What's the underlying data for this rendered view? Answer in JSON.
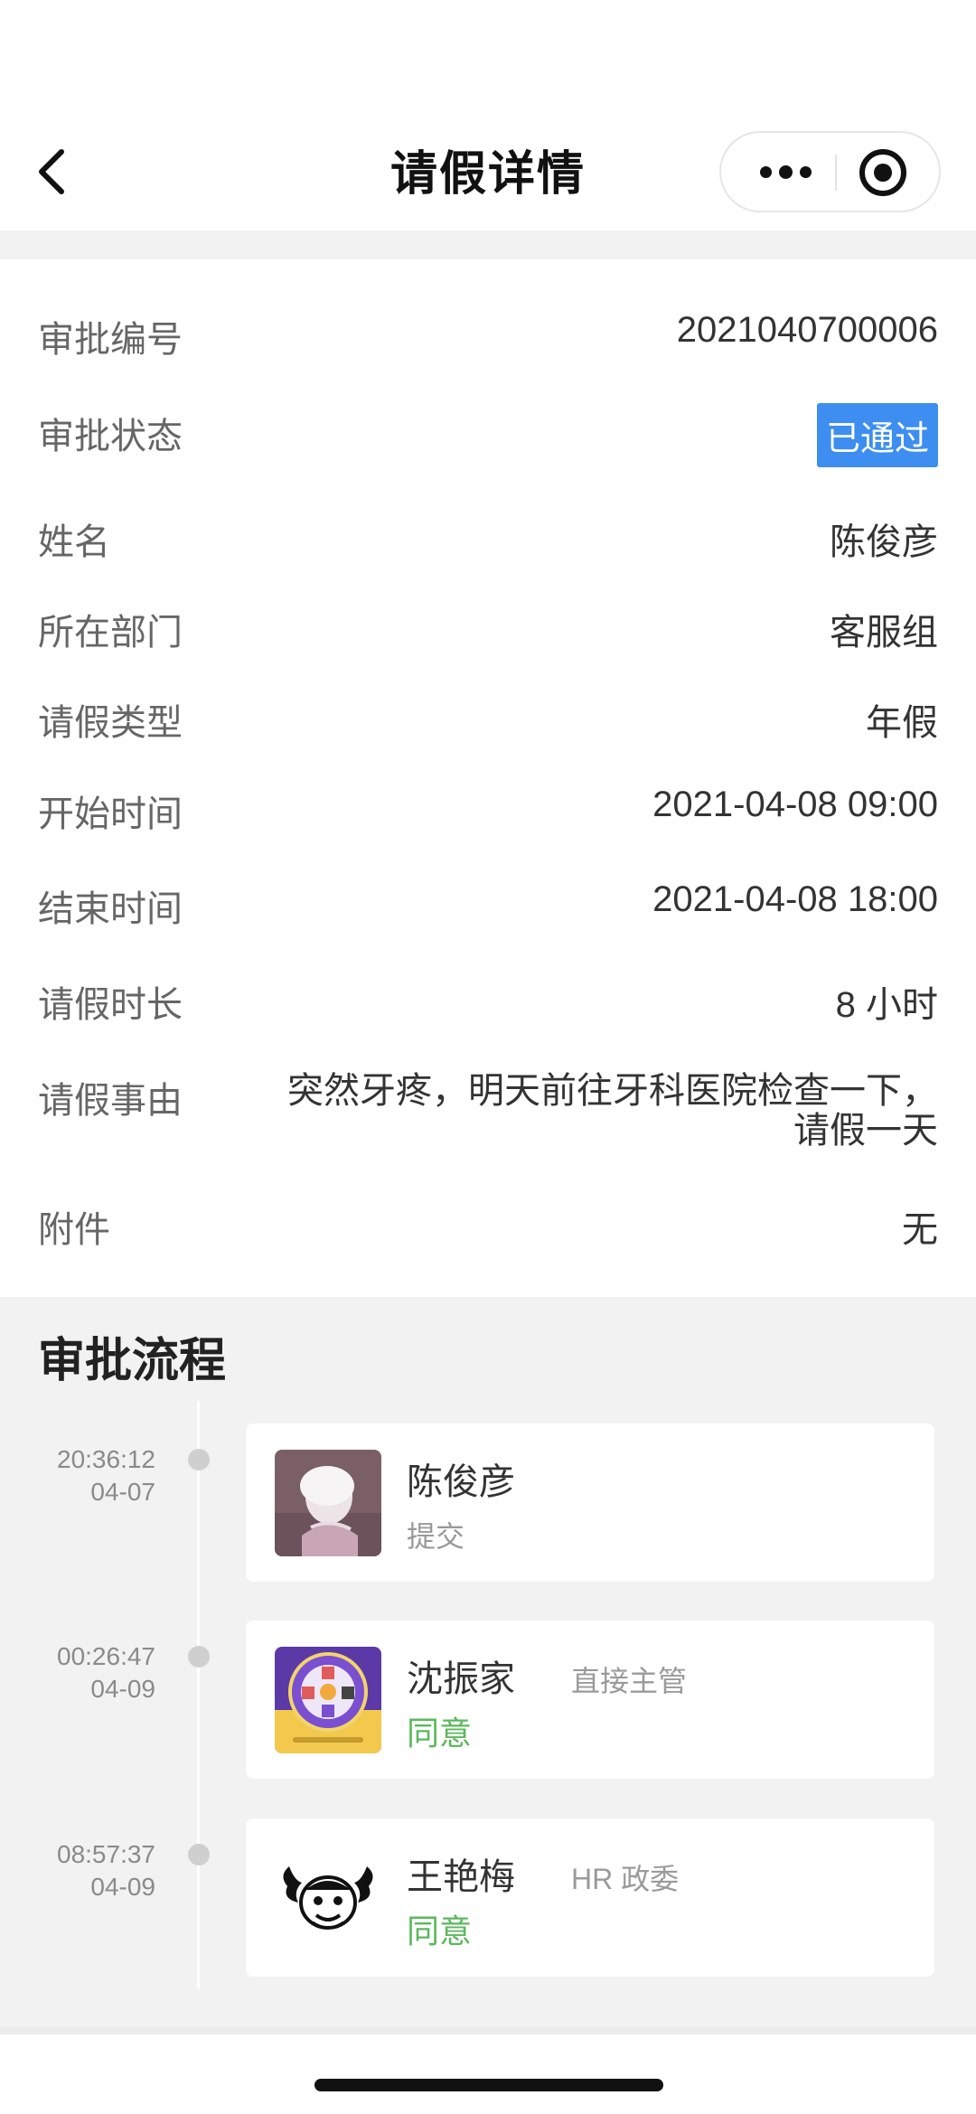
{
  "nav": {
    "title": "请假详情"
  },
  "details": {
    "approval_no_label": "审批编号",
    "approval_no": "2021040700006",
    "status_label": "审批状态",
    "status": "已通过",
    "status_color": "#3d8ef0",
    "name_label": "姓名",
    "name": "陈俊彦",
    "dept_label": "所在部门",
    "dept": "客服组",
    "type_label": "请假类型",
    "type": "年假",
    "start_label": "开始时间",
    "start": "2021-04-08 09:00",
    "end_label": "结束时间",
    "end": "2021-04-08 18:00",
    "duration_label": "请假时长",
    "duration": "8 小时",
    "reason_label": "请假事由",
    "reason_line1": "突然牙疼，明天前往牙科医院检查一下，",
    "reason_line2": "请假一天",
    "attachment_label": "附件",
    "attachment": "无"
  },
  "flow": {
    "title": "审批流程",
    "approved_color": "#5cb85c",
    "items": [
      {
        "time": "20:36:12",
        "date": "04-07",
        "name": "陈俊彦",
        "role": "",
        "action": "提交",
        "avatar_icon": "anime-avatar-icon"
      },
      {
        "time": "00:26:47",
        "date": "04-09",
        "name": "沈振家",
        "role": "直接主管",
        "action": "同意",
        "avatar_icon": "prize-wheel-avatar-icon"
      },
      {
        "time": "08:57:37",
        "date": "04-09",
        "name": "王艳梅",
        "role": "HR 政委",
        "action": "同意",
        "avatar_icon": "cartoon-face-avatar-icon"
      }
    ]
  }
}
